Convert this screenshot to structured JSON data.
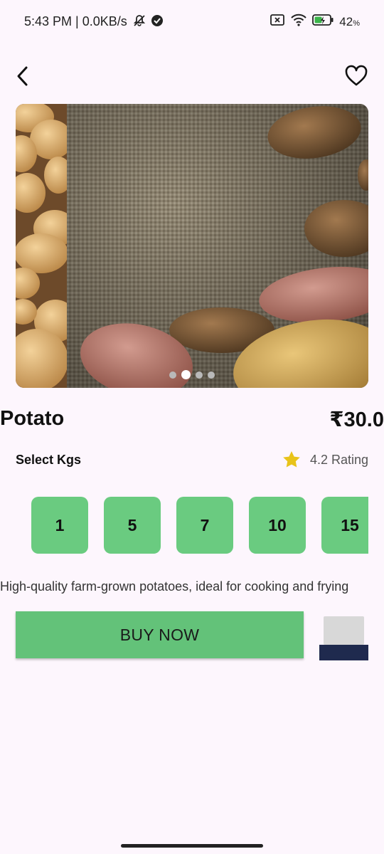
{
  "status_bar": {
    "time_speed": "5:43 PM | 0.0KB/s",
    "battery": "42",
    "battery_unit": "%"
  },
  "header": {
    "back_icon": "chevron-left-icon",
    "favorite_icon": "heart-outline-icon"
  },
  "gallery": {
    "image": "potatoes on burlap sack",
    "slide_count": 4,
    "active_index": 1
  },
  "product": {
    "name": "Potato",
    "price": "₹30.0",
    "select_label": "Select Kgs",
    "rating_text": "4.2 Rating",
    "description": "High-quality farm-grown potatoes, ideal for cooking and frying"
  },
  "kg_options": [
    "1",
    "5",
    "7",
    "10",
    "15"
  ],
  "actions": {
    "buy_label": "BUY NOW"
  },
  "colors": {
    "background": "#fdf6fd",
    "chip_green": "#6acb80",
    "button_green": "#63c279",
    "star_yellow": "#e8c31a",
    "cart_navy": "#1f2a4e"
  }
}
